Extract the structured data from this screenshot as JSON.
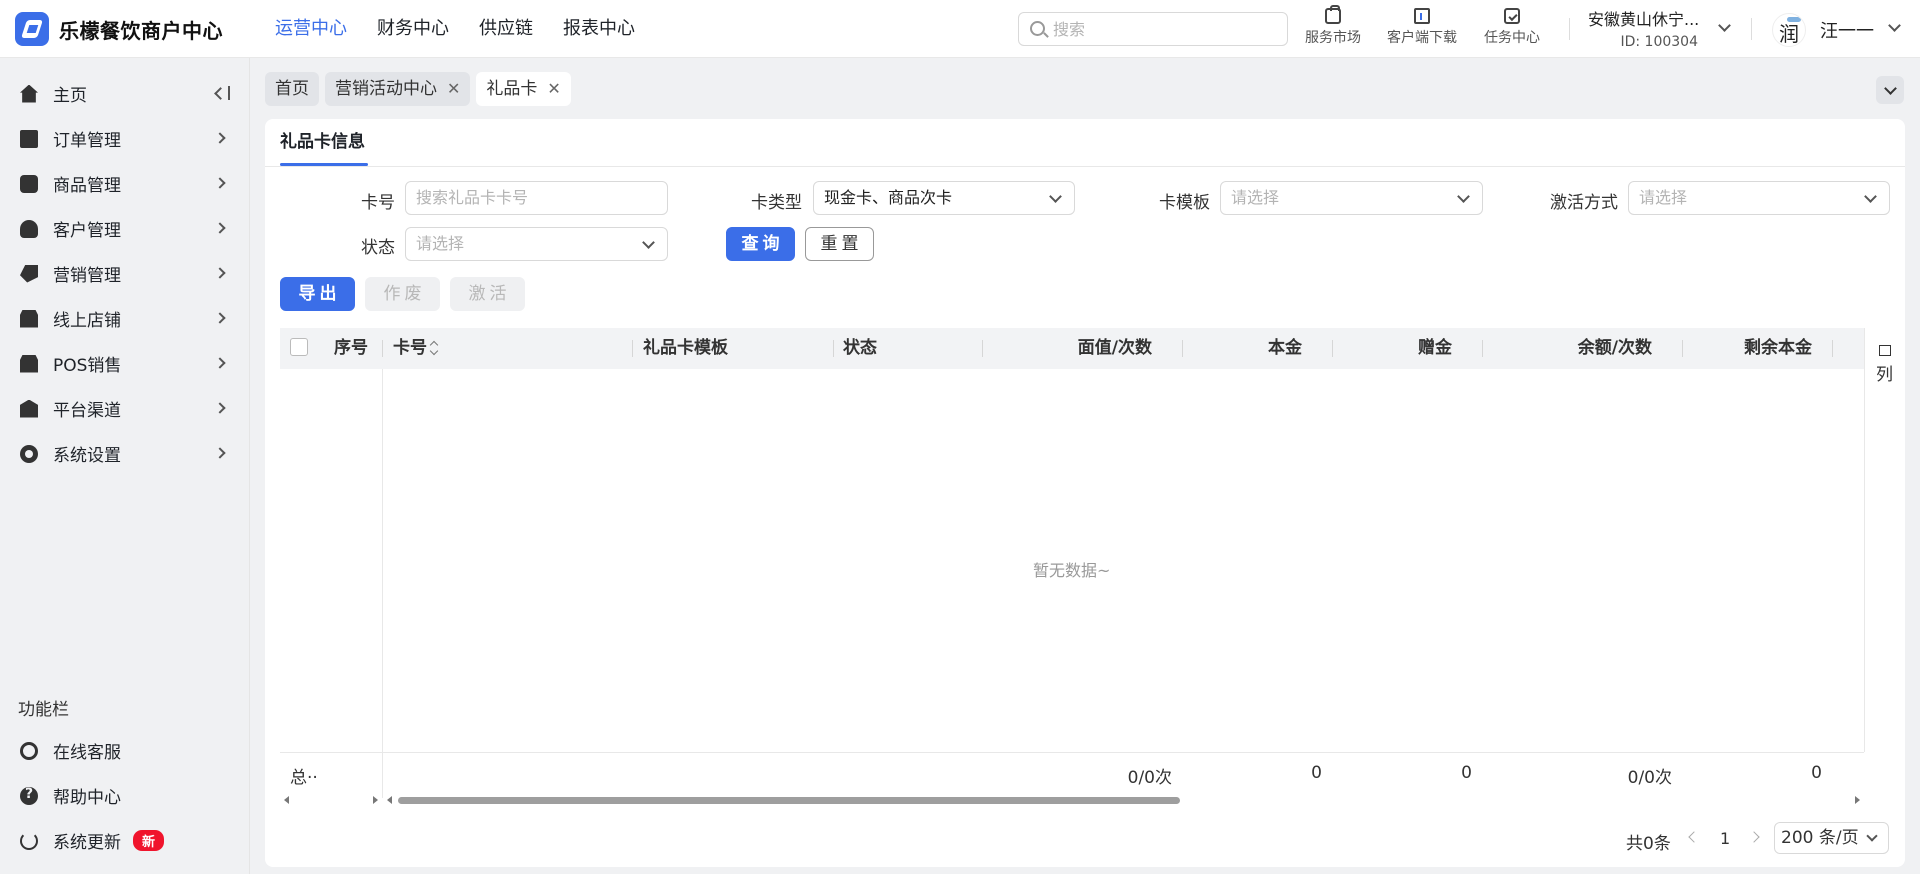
{
  "app": {
    "title": "乐檬餐饮商户中心"
  },
  "topnav": [
    "运营中心",
    "财务中心",
    "供应链",
    "报表中心"
  ],
  "search": {
    "placeholder": "搜索"
  },
  "tools": {
    "market": "服务市场",
    "download": "客户端下载",
    "task": "任务中心"
  },
  "store": {
    "name": "安徽黄山休宁...",
    "id": "ID: 100304"
  },
  "user": {
    "name": "汪一一"
  },
  "sidebar": {
    "items": [
      "主页",
      "订单管理",
      "商品管理",
      "客户管理",
      "营销管理",
      "线上店铺",
      "POS销售",
      "平台渠道",
      "系统设置"
    ],
    "func_title": "功能栏",
    "func_items": [
      "在线客服",
      "帮助中心",
      "系统更新"
    ],
    "new_badge": "新"
  },
  "tabs": [
    "首页",
    "营销活动中心",
    "礼品卡"
  ],
  "card": {
    "tab": "礼品卡信息"
  },
  "filters": {
    "card_no": {
      "label": "卡号",
      "placeholder": "搜索礼品卡卡号"
    },
    "card_type": {
      "label": "卡类型",
      "value": "现金卡、商品次卡"
    },
    "template": {
      "label": "卡模板",
      "placeholder": "请选择"
    },
    "activation": {
      "label": "激活方式",
      "placeholder": "请选择"
    },
    "status": {
      "label": "状态",
      "placeholder": "请选择"
    },
    "query_btn": "查询",
    "reset_btn": "重置"
  },
  "actions": {
    "export": "导出",
    "void": "作废",
    "activate": "激活"
  },
  "table": {
    "columns": [
      "序号",
      "卡号",
      "礼品卡模板",
      "状态",
      "面值/次数",
      "本金",
      "赠金",
      "余额/次数",
      "剩余本金"
    ],
    "col_setting": "列",
    "empty": "暂无数据~",
    "footer": {
      "label": "总··",
      "face": "0/0次",
      "principal": "0",
      "gift": "0",
      "balance": "0/0次",
      "remaining": "0"
    }
  },
  "pagination": {
    "total": "共0条",
    "page": "1",
    "size": "200 条/页"
  }
}
